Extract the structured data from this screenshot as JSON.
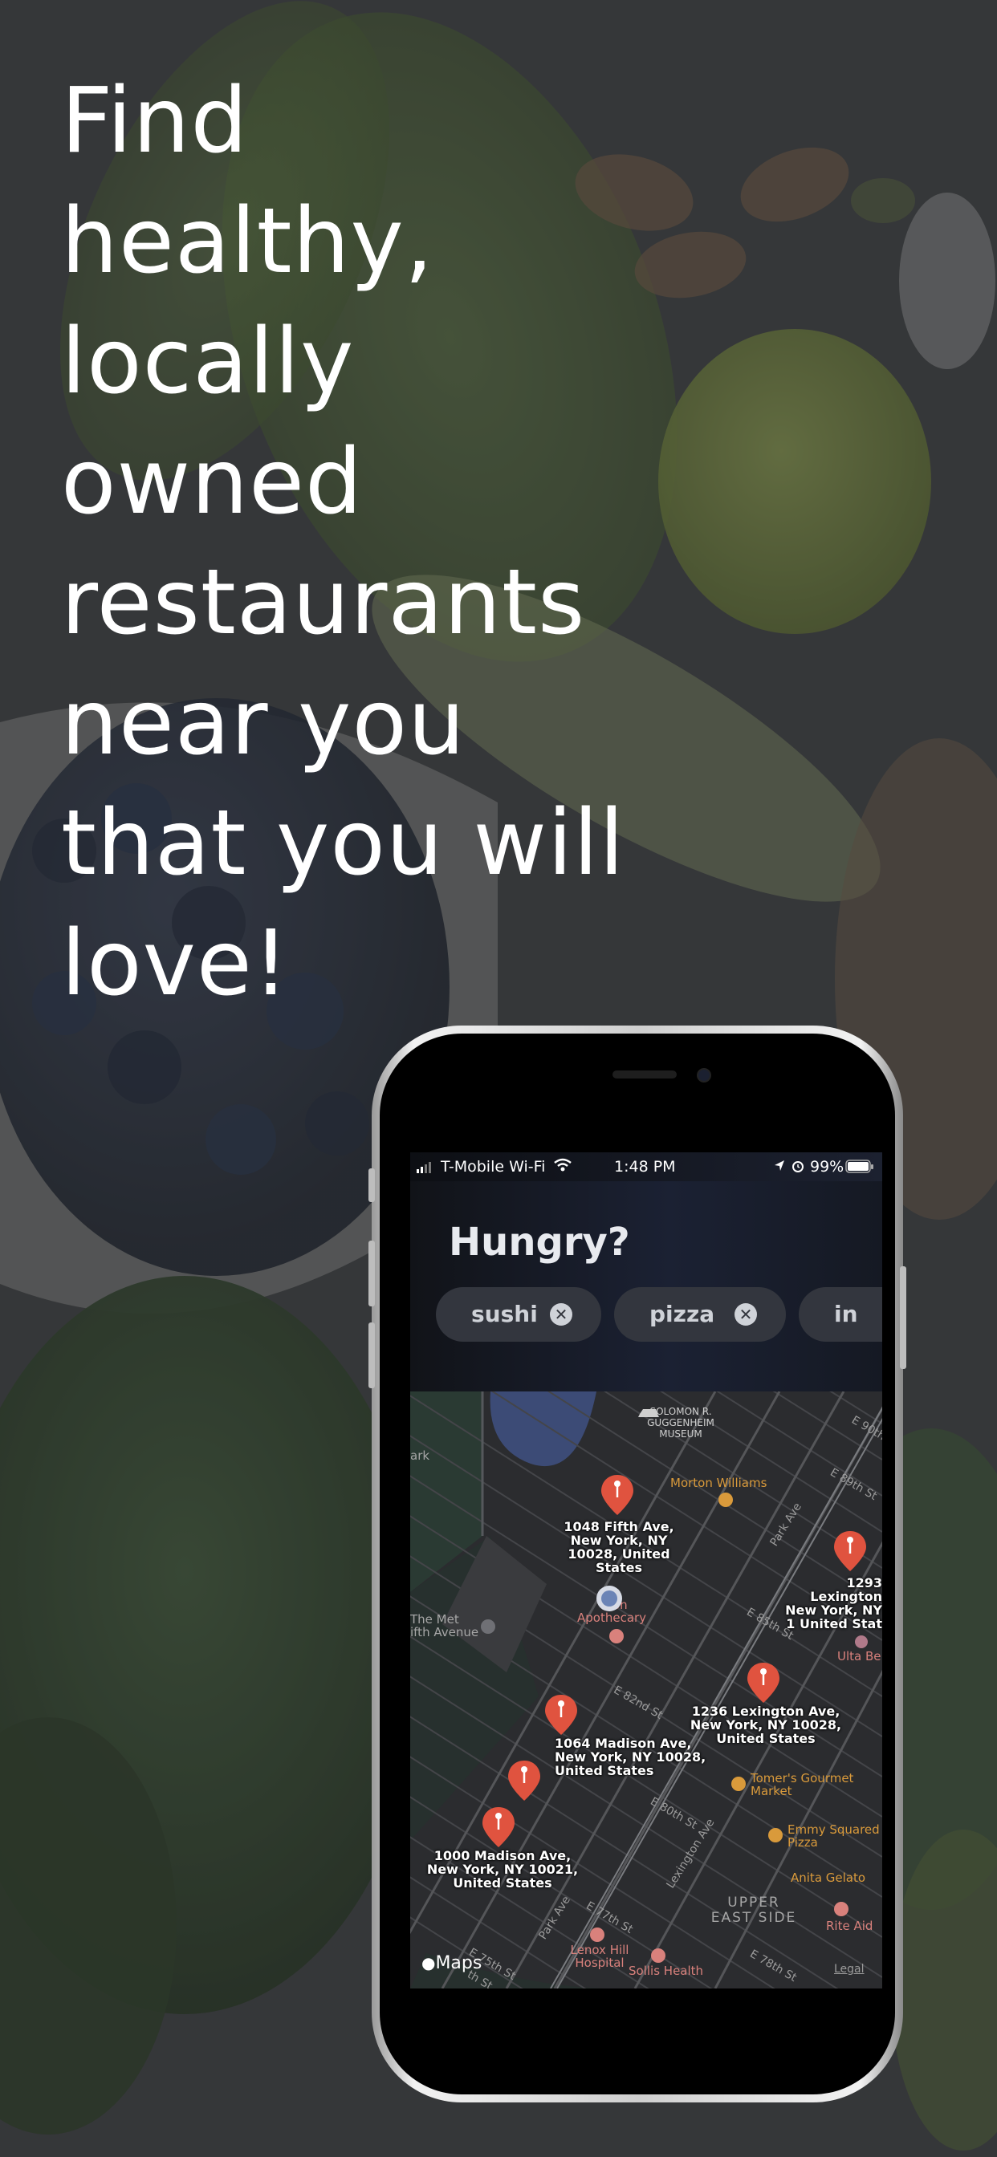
{
  "headline": [
    "Find",
    "healthy,",
    "locally",
    "owned",
    "restaurants",
    "near you",
    "that you will",
    "love!"
  ],
  "statusbar": {
    "carrier": "T-Mobile Wi-Fi",
    "time": "1:48 PM",
    "battery": "99%"
  },
  "app": {
    "title": "Hungry?",
    "chips": [
      {
        "label": "sushi"
      },
      {
        "label": "pizza"
      },
      {
        "label": "in"
      }
    ]
  },
  "map": {
    "pins": [
      {
        "address": "1048 Fifth Ave, New York, NY 10028, United States"
      },
      {
        "address": "1293 Lexington New York, NY 1 United Stat"
      },
      {
        "address": "1236 Lexington Ave, New York, NY 10028, United States"
      },
      {
        "address": "1064 Madison Ave, New York, NY 10028, United States"
      },
      {
        "address": ""
      },
      {
        "address": "1000 Madison Ave, New York, NY 10021, United States"
      }
    ],
    "pois": {
      "guggenheim": "SOLOMON R. GUGGENHEIM MUSEUM",
      "morton": "Morton Williams",
      "apothecary": "Apothecary",
      "apothecary_top": "on",
      "met": "The Met ifth Avenue",
      "ulta": "Ulta Be",
      "tomers": "Tomer's Gourmet Market",
      "emmy": "Emmy Squared Pizza",
      "anita": "Anita Gelato",
      "riteaid": "Rite Aid",
      "upper_east": "UPPER EAST SIDE",
      "lenox": "Lenox Hill Hospital",
      "sollis": "Sollis Health",
      "ark": "ark"
    },
    "streets": {
      "e90": "E 90th",
      "e89": "E 89th St",
      "parkave_top": "Park Ave",
      "e85": "E 85th St",
      "e82": "E 82nd St",
      "e80": "E 80th St",
      "lexington": "Lexington Ave",
      "parkave_bottom": "Park Ave",
      "e77": "E 77th St",
      "e75": "E 75th St",
      "e78": "E 78th St",
      "e76": "th St"
    },
    "maps_label": "Maps",
    "legal": "Legal"
  },
  "colors": {
    "pin": "#e0533f",
    "poi_gold": "#d99a3b",
    "poi_red": "#d9817c"
  }
}
